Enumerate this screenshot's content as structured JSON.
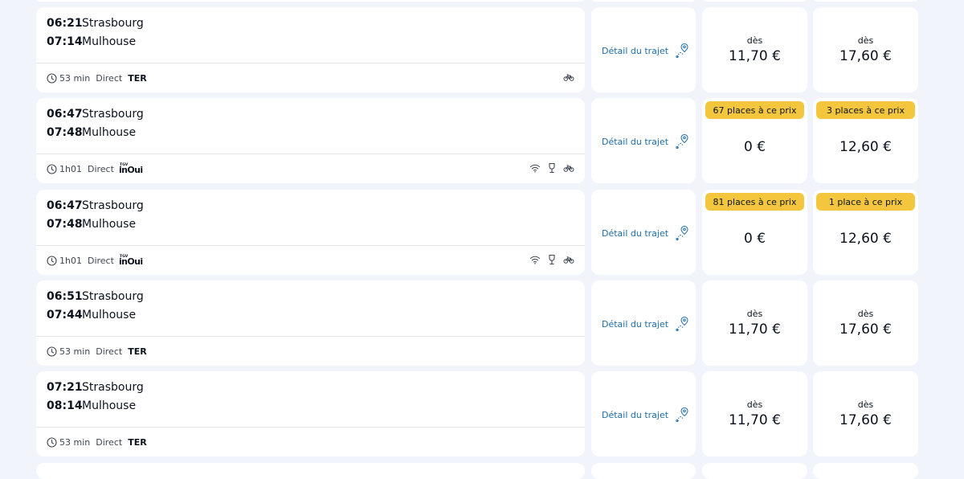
{
  "labels": {
    "detail": "Détail du trajet"
  },
  "journeys": [
    {
      "dep_time": "06:21",
      "dep_city": "Strasbourg",
      "arr_time": "07:14",
      "arr_city": "Mulhouse",
      "duration": "53 min",
      "type": "Direct",
      "carrier": "TER",
      "carrier_logo": "",
      "amenities": [
        "bike-icon"
      ],
      "fare1": {
        "badge": "",
        "from": "dès",
        "amount": "11,70 €"
      },
      "fare2": {
        "badge": "",
        "from": "dès",
        "amount": "17,60 €"
      }
    },
    {
      "dep_time": "06:47",
      "dep_city": "Strasbourg",
      "arr_time": "07:48",
      "arr_city": "Mulhouse",
      "duration": "1h01",
      "type": "Direct",
      "carrier": "",
      "carrier_logo": "TGV INOUI",
      "amenities": [
        "wifi-icon",
        "bar-icon",
        "bike-icon"
      ],
      "fare1": {
        "badge": "67 places à ce prix",
        "from": "",
        "amount": "0 €"
      },
      "fare2": {
        "badge": "3 places à ce prix",
        "from": "",
        "amount": "12,60 €"
      }
    },
    {
      "dep_time": "06:47",
      "dep_city": "Strasbourg",
      "arr_time": "07:48",
      "arr_city": "Mulhouse",
      "duration": "1h01",
      "type": "Direct",
      "carrier": "",
      "carrier_logo": "TGV INOUI",
      "amenities": [
        "wifi-icon",
        "bar-icon",
        "bike-icon"
      ],
      "fare1": {
        "badge": "81 places à ce prix",
        "from": "",
        "amount": "0 €"
      },
      "fare2": {
        "badge": "1 place à ce prix",
        "from": "",
        "amount": "12,60 €"
      }
    },
    {
      "dep_time": "06:51",
      "dep_city": "Strasbourg",
      "arr_time": "07:44",
      "arr_city": "Mulhouse",
      "duration": "53 min",
      "type": "Direct",
      "carrier": "TER",
      "carrier_logo": "",
      "amenities": [],
      "fare1": {
        "badge": "",
        "from": "dès",
        "amount": "11,70 €"
      },
      "fare2": {
        "badge": "",
        "from": "dès",
        "amount": "17,60 €"
      }
    },
    {
      "dep_time": "07:21",
      "dep_city": "Strasbourg",
      "arr_time": "08:14",
      "arr_city": "Mulhouse",
      "duration": "53 min",
      "type": "Direct",
      "carrier": "TER",
      "carrier_logo": "",
      "amenities": [],
      "fare1": {
        "badge": "",
        "from": "dès",
        "amount": "11,70 €"
      },
      "fare2": {
        "badge": "",
        "from": "dès",
        "amount": "17,60 €"
      }
    }
  ],
  "colors": {
    "background": "#f1f4fb",
    "card": "#ffffff",
    "badge": "#f4c63d",
    "link": "#1d6dab"
  }
}
